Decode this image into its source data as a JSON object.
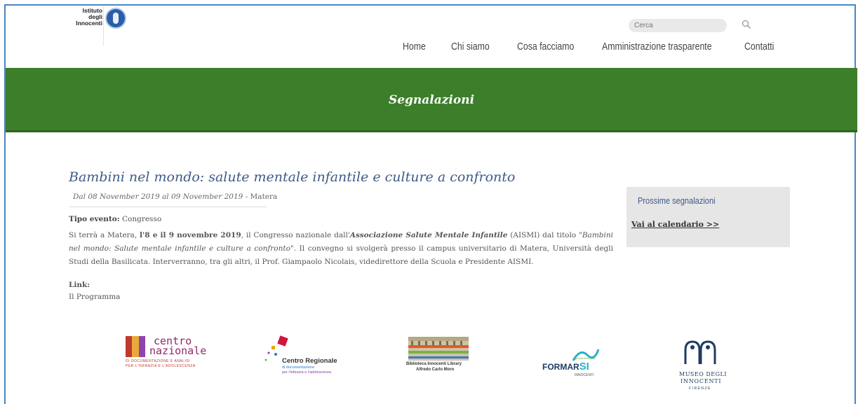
{
  "header": {
    "logo_text": "Istituto degli Innocenti",
    "search_placeholder": "Cerca",
    "nav": [
      "Home",
      "Chi siamo",
      "Cosa facciamo",
      "Amministrazione trasparente",
      "Contatti"
    ]
  },
  "banner": {
    "title": "Segnalazioni",
    "color": "#3d7e2a"
  },
  "event": {
    "title": "Bambini nel mondo: salute mentale infantile e culture a confronto",
    "date_range": "Dal 08 November 2019 al 09 November 2019",
    "location": " - Matera",
    "type_label": "Tipo evento:",
    "type_value": " Congresso",
    "desc_1": "Si terrà a Matera, ",
    "desc_dates": "l'8 e il 9 novembre 2019",
    "desc_2": ", il Congresso nazionale dall'",
    "desc_assoc": "Associazione Salute Mentale Infantile",
    "desc_3": " (AISMI) dal titolo \"",
    "desc_title": "Bambini nel mondo: Salute mentale infantile e culture a confronto",
    "desc_4": "\". Il convegno si svolgerà presso il campus universitario di Matera, Università degli Studi della Basilicata. Interverranno, tra gli altri, il Prof. Giampaolo Nicolais, videdirettore della Scuola e Presidente AISMI.",
    "link_label": "Link:",
    "link_item": "Il Programma"
  },
  "sidebar": {
    "title": "Prossime segnalazioni",
    "link": "Vai al calendario >>"
  },
  "partners": {
    "p1_word1": "centro",
    "p1_word2": "nazionale",
    "p1_sub1": "DI DOCUMENTAZIONE E ANALISI",
    "p1_sub2": "PER L'INFANZIA E L'ADOLESCENZA",
    "p2_title": "Centro Regionale",
    "p2_sub1": "di documentazione",
    "p2_sub2": "per l'infanzia e l'adolescenza",
    "p3_line1": "Biblioteca Innocenti Library",
    "p3_line2": "Alfredo Carlo Moro",
    "p4_small": "agenzia formativa",
    "p4_main": "FORMAR",
    "p4_si": "SI",
    "p4_sub": "INNOCENTI",
    "p5_line1": "MUSEO DEGLI",
    "p5_line2": "INNOCENTI",
    "p5_line3": "FIRENZE"
  }
}
